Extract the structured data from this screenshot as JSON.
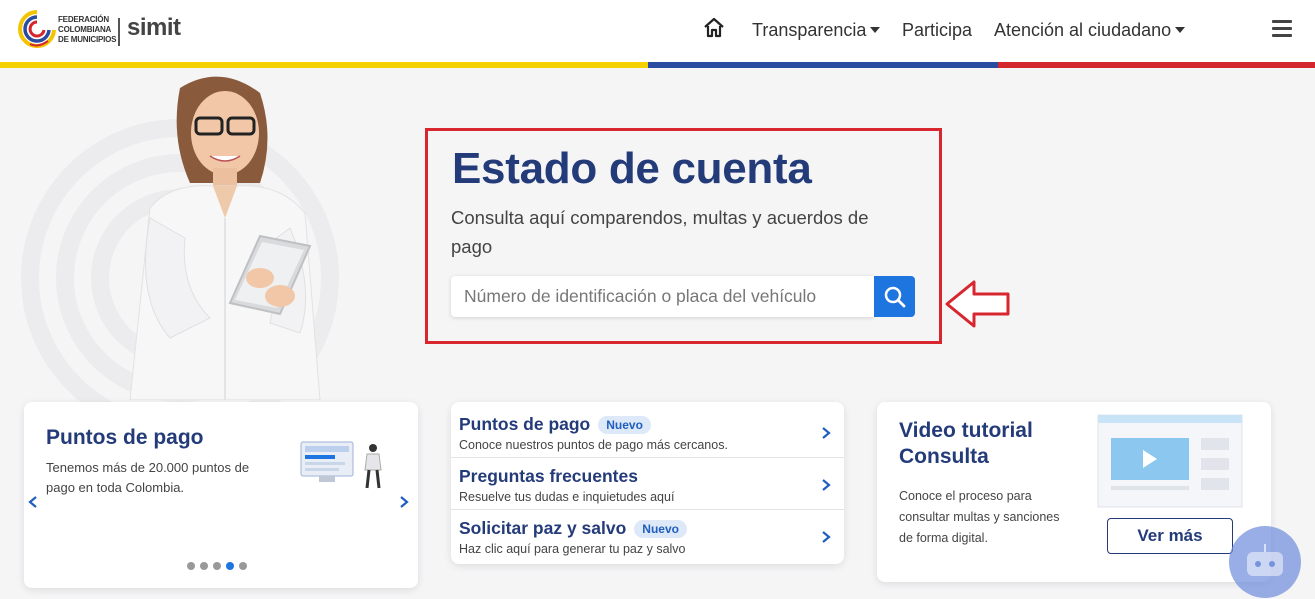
{
  "header": {
    "logo_org_lines": [
      "FEDERACIÓN",
      "COLOMBIANA",
      "DE MUNICIPIOS"
    ],
    "logo_brand": "simit",
    "nav": {
      "home_icon": "home-icon",
      "transparencia": "Transparencia",
      "participa": "Participa",
      "atencion": "Atención al ciudadano",
      "menu_icon": "hamburger-icon"
    },
    "flag_colors": [
      "#f5d100",
      "#2a4ca0",
      "#d3262e"
    ]
  },
  "hero": {
    "title": "Estado de cuenta",
    "subtitle": "Consulta aquí comparendos, multas y acuerdos de pago",
    "search_placeholder": "Número de identificación o placa del vehículo",
    "search_icon": "search-icon",
    "highlight_color": "#d7262e"
  },
  "cards": {
    "puntos": {
      "title": "Puntos de pago",
      "text": "Tenemos más de 20.000 puntos de pago en toda Colombia.",
      "carousel_dots": 5,
      "active_dot": 4
    },
    "links": [
      {
        "title": "Puntos de pago",
        "badge": "Nuevo",
        "desc": "Conoce nuestros puntos de pago más cercanos."
      },
      {
        "title": "Preguntas frecuentes",
        "badge": "",
        "desc": "Resuelve tus dudas e inquietudes aquí"
      },
      {
        "title": "Solicitar paz y salvo",
        "badge": "Nuevo",
        "desc": "Haz clic aquí para generar tu paz y salvo"
      }
    ],
    "video": {
      "title": "Video tutorial Consulta",
      "text": "Conoce el proceso para consultar multas y sanciones de forma digital.",
      "button": "Ver más"
    }
  },
  "colors": {
    "primary_blue": "#243b7a",
    "accent_blue": "#1f75e0"
  }
}
